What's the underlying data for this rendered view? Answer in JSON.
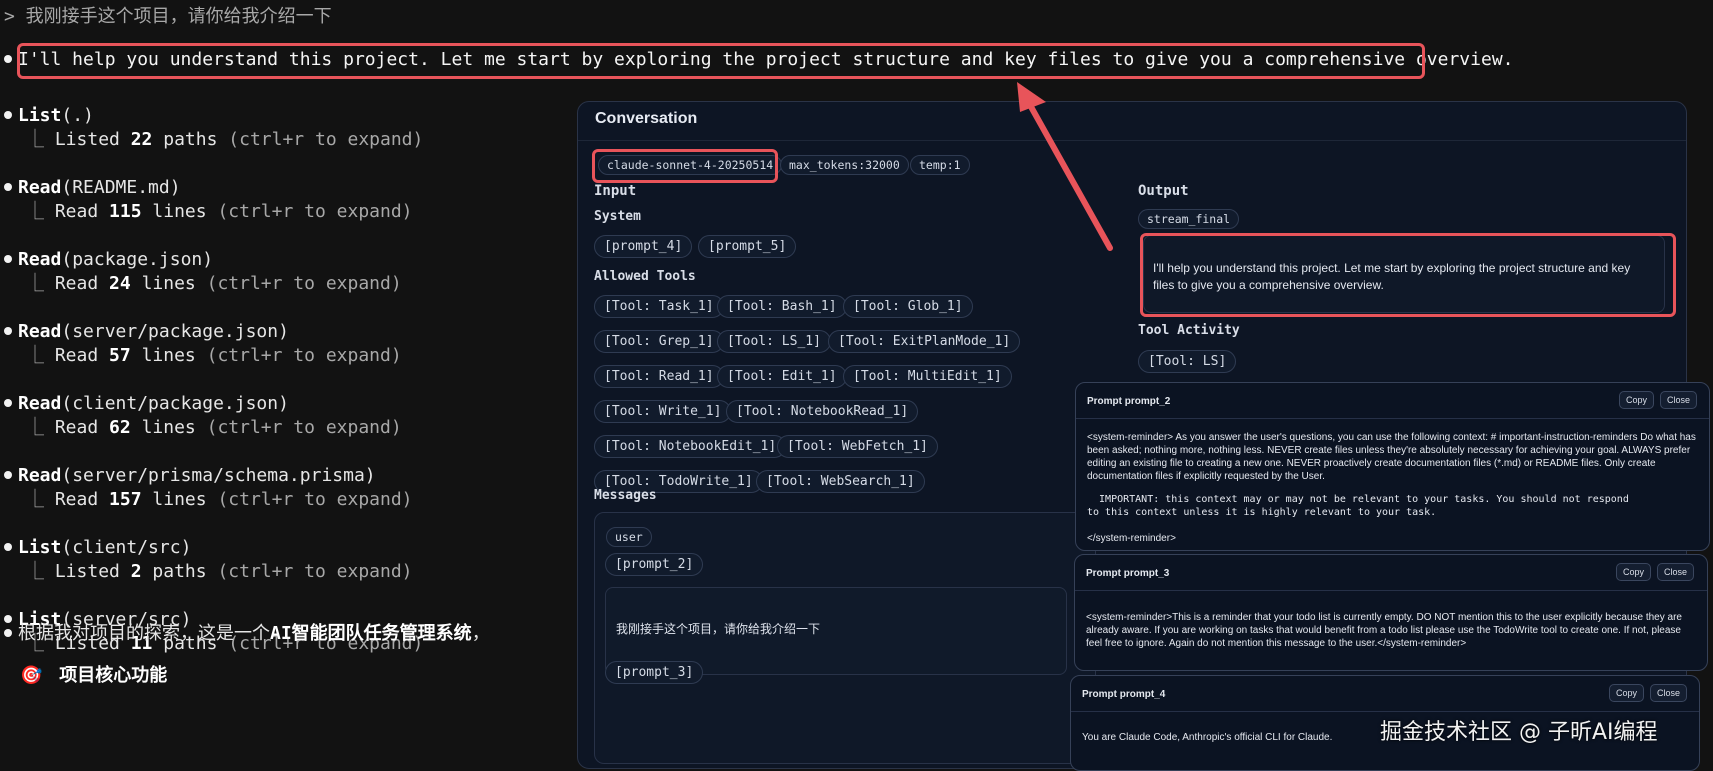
{
  "terminal": {
    "prompt_line": "> 我刚接手这个项目，请你给我介绍一下",
    "assistant_intro": "I'll help you understand this project. Let me start by exploring the project structure and key files to give you a comprehensive overview.",
    "tool_calls": [
      {
        "tool": "List",
        "arg": "(.)",
        "result_verb": "Listed",
        "count": "22",
        "unit": "paths",
        "hint": "(ctrl+r to expand)"
      },
      {
        "tool": "Read",
        "arg": "(README.md)",
        "result_verb": "Read",
        "count": "115",
        "unit": "lines",
        "hint": "(ctrl+r to expand)"
      },
      {
        "tool": "Read",
        "arg": "(package.json)",
        "result_verb": "Read",
        "count": "24",
        "unit": "lines",
        "hint": "(ctrl+r to expand)"
      },
      {
        "tool": "Read",
        "arg": "(server/package.json)",
        "result_verb": "Read",
        "count": "57",
        "unit": "lines",
        "hint": "(ctrl+r to expand)"
      },
      {
        "tool": "Read",
        "arg": "(client/package.json)",
        "result_verb": "Read",
        "count": "62",
        "unit": "lines",
        "hint": "(ctrl+r to expand)"
      },
      {
        "tool": "Read",
        "arg": "(server/prisma/schema.prisma)",
        "result_verb": "Read",
        "count": "157",
        "unit": "lines",
        "hint": "(ctrl+r to expand)"
      },
      {
        "tool": "List",
        "arg": "(client/src)",
        "result_verb": "Listed",
        "count": "2",
        "unit": "paths",
        "hint": "(ctrl+r to expand)"
      },
      {
        "tool": "List",
        "arg": "(server/src)",
        "result_verb": "Listed",
        "count": "11",
        "unit": "paths",
        "hint": "(ctrl+r to expand)"
      }
    ],
    "summary_prefix": "根据我对项目的探索，这是一个",
    "summary_bold": "AI智能团队任务管理系统",
    "summary_suffix": "，",
    "section_icon": "🎯",
    "section_title": "项目核心功能",
    "tree_glyph": "⎿"
  },
  "conversation": {
    "title": "Conversation",
    "model_chip": "claude-sonnet-4-20250514",
    "max_tokens_chip": "max_tokens:32000",
    "temp_chip": "temp:1",
    "input_label": "Input",
    "system_label": "System",
    "system_prompts": [
      "[prompt_4]",
      "[prompt_5]"
    ],
    "allowed_tools_label": "Allowed Tools",
    "tools": [
      "[Tool: Task_1]",
      "[Tool: Bash_1]",
      "[Tool: Glob_1]",
      "[Tool: Grep_1]",
      "[Tool: LS_1]",
      "[Tool: ExitPlanMode_1]",
      "[Tool: Read_1]",
      "[Tool: Edit_1]",
      "[Tool: MultiEdit_1]",
      "[Tool: Write_1]",
      "[Tool: NotebookRead_1]",
      "[Tool: NotebookEdit_1]",
      "[Tool: WebFetch_1]",
      "[Tool: TodoWrite_1]",
      "[Tool: WebSearch_1]"
    ],
    "messages_label": "Messages",
    "message_role": "user",
    "message_prompt_a": "[prompt_2]",
    "message_text": "我刚接手这个项目，请你给我介绍一下",
    "message_prompt_b": "[prompt_3]",
    "output_label": "Output",
    "output_chip": "stream_final",
    "output_text": "I'll help you understand this project. Let me start by exploring the project structure and key files to give you a comprehensive overview.",
    "tool_activity_label": "Tool Activity",
    "tool_activity_chip": "[Tool: LS]"
  },
  "popups": [
    {
      "title": "Prompt prompt_2",
      "copy": "Copy",
      "close": "Close",
      "body": "<system-reminder> As you answer the user's questions, you can use the following context: # important-instruction-reminders Do what has been asked; nothing more, nothing less. NEVER create files unless they're absolutely necessary for achieving your goal. ALWAYS prefer editing an existing file to creating a new one. NEVER proactively create documentation files (*.md) or README files. Only create documentation files if explicitly requested by the User.",
      "mono": "  IMPORTANT: this context may or may not be relevant to your tasks. You should not respond\nto this context unless it is highly relevant to your task.",
      "end": "</system-reminder>"
    },
    {
      "title": "Prompt prompt_3",
      "copy": "Copy",
      "close": "Close",
      "body": "<system-reminder>This is a reminder that your todo list is currently empty. DO NOT mention this to the user explicitly because they are already aware. If you are working on tasks that would benefit from a todo list please use the TodoWrite tool to create one. If not, please feel free to ignore. Again do not mention this message to the user.</system-reminder>"
    },
    {
      "title": "Prompt prompt_4",
      "copy": "Copy",
      "close": "Close",
      "body": "You are Claude Code, Anthropic's official CLI for Claude."
    }
  ],
  "watermark": "掘金技术社区 @ 子昕AI编程",
  "colors": {
    "highlight": "#e8545a",
    "terminal_bg": "#121212",
    "panel_bg": "#0d1524"
  },
  "icons": [
    "bullet-dot-icon",
    "tree-branch-icon",
    "target-icon",
    "annotation-arrow-icon"
  ]
}
